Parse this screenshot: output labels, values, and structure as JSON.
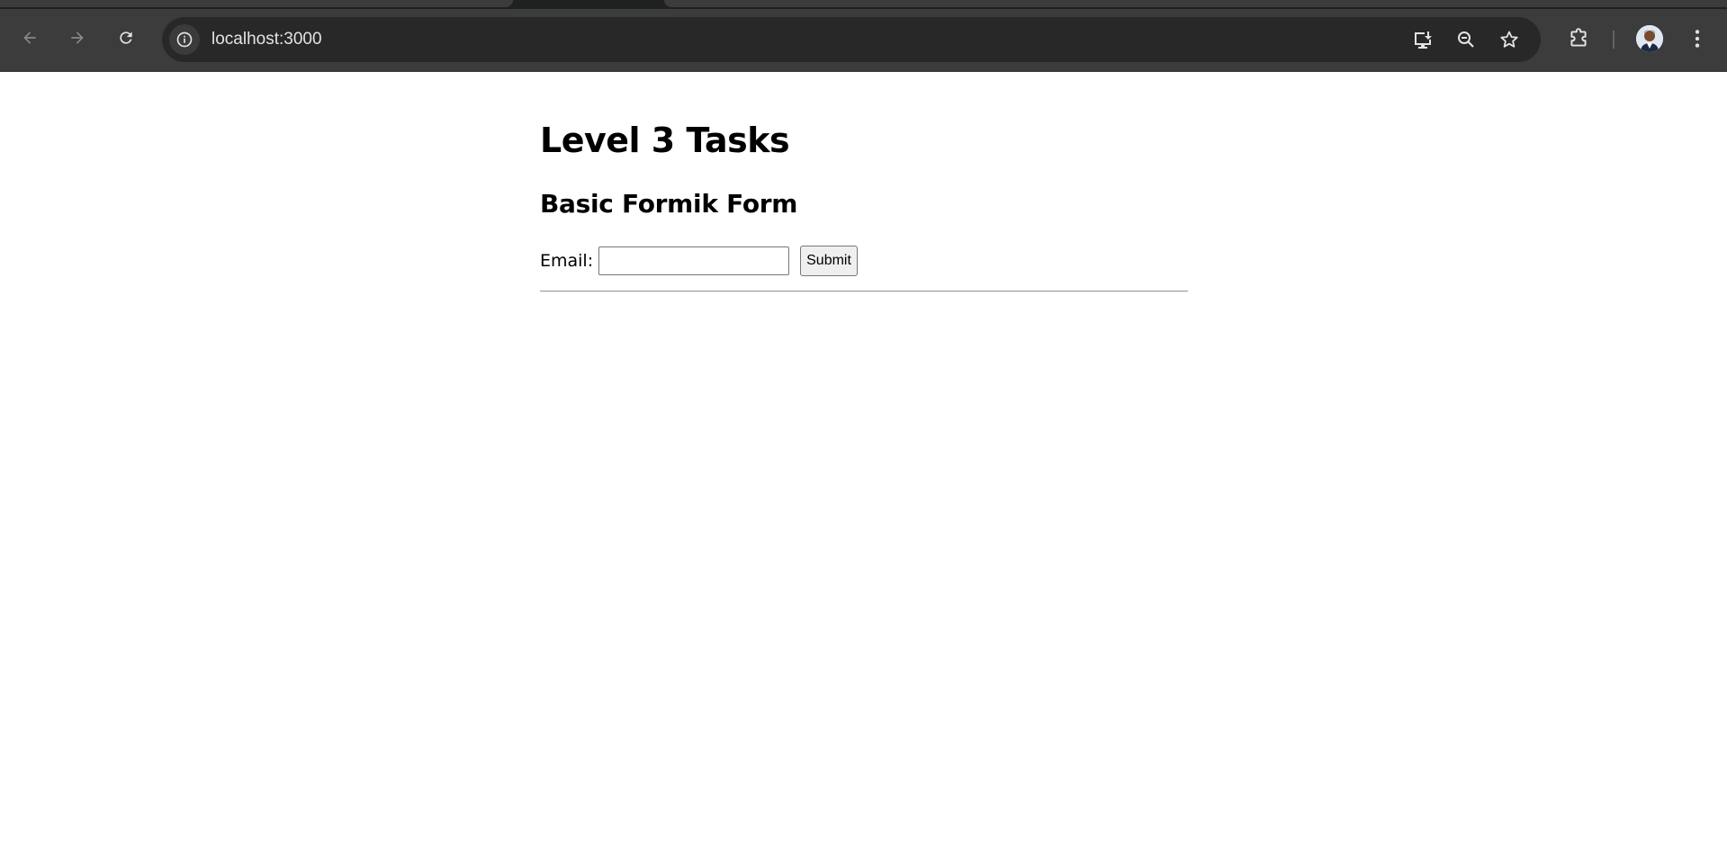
{
  "browser": {
    "url": "localhost:3000",
    "icons": {
      "back": "back-arrow-icon",
      "forward": "forward-arrow-icon",
      "reload": "reload-icon",
      "site_info": "info-icon",
      "install": "install-app-icon",
      "zoom": "zoom-out-icon",
      "bookmark": "star-icon",
      "extensions": "puzzle-icon",
      "profile": "avatar",
      "menu": "kebab-menu-icon"
    }
  },
  "page": {
    "heading": "Level 3 Tasks",
    "subheading": "Basic Formik Form",
    "form": {
      "email_label": "Email:",
      "email_value": "",
      "submit_label": "Submit"
    }
  },
  "colors": {
    "chrome_bg": "#3c3c3c",
    "omnibox_bg": "#282828",
    "url_text": "#e3e3e3",
    "page_bg": "#ffffff"
  }
}
